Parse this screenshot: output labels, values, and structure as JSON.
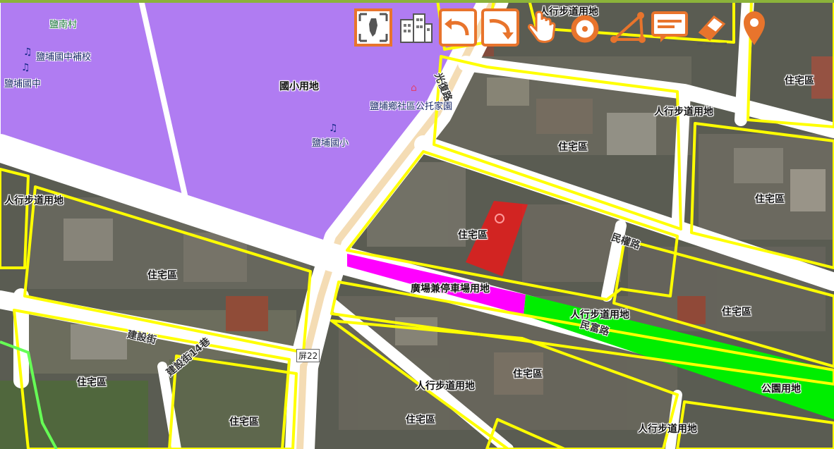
{
  "map": {
    "zones": {
      "school": "國小用地",
      "residential": "住宅區",
      "walkway": "人行步道用地",
      "plaza_parking": "廣場兼停車場用地",
      "park": "公園用地"
    },
    "villages": {
      "yannan": "鹽南村"
    },
    "pois": {
      "jh_tutoring": "鹽埔國中補校",
      "jh": "鹽埔國中",
      "elementary": "鹽埔國小",
      "community_daycare": "鹽埔鄉社區公托家園"
    },
    "roads": {
      "guangfu": "光復路",
      "minquan": "民權路",
      "minfu": "民富路",
      "jianshe": "建設街",
      "jianshe_lane": "建設街14巷",
      "route": "屏22"
    },
    "colors": {
      "school_fill": "#b07cf2",
      "walkway_fill": "#ff00ff",
      "park_fill": "#00ee00",
      "boundary": "#ffff00",
      "highlight": "#e81a1a",
      "tool_orange": "#e8742c"
    }
  },
  "toolbar": {
    "tools": [
      {
        "name": "fullscreen-icon"
      },
      {
        "name": "buildings-icon"
      },
      {
        "name": "undo-icon"
      },
      {
        "name": "redo-icon"
      },
      {
        "name": "pan-hand-icon"
      },
      {
        "name": "circle-measure-icon"
      },
      {
        "name": "polygon-measure-icon"
      },
      {
        "name": "annotation-icon"
      },
      {
        "name": "eraser-icon"
      },
      {
        "name": "marker-icon"
      }
    ]
  }
}
